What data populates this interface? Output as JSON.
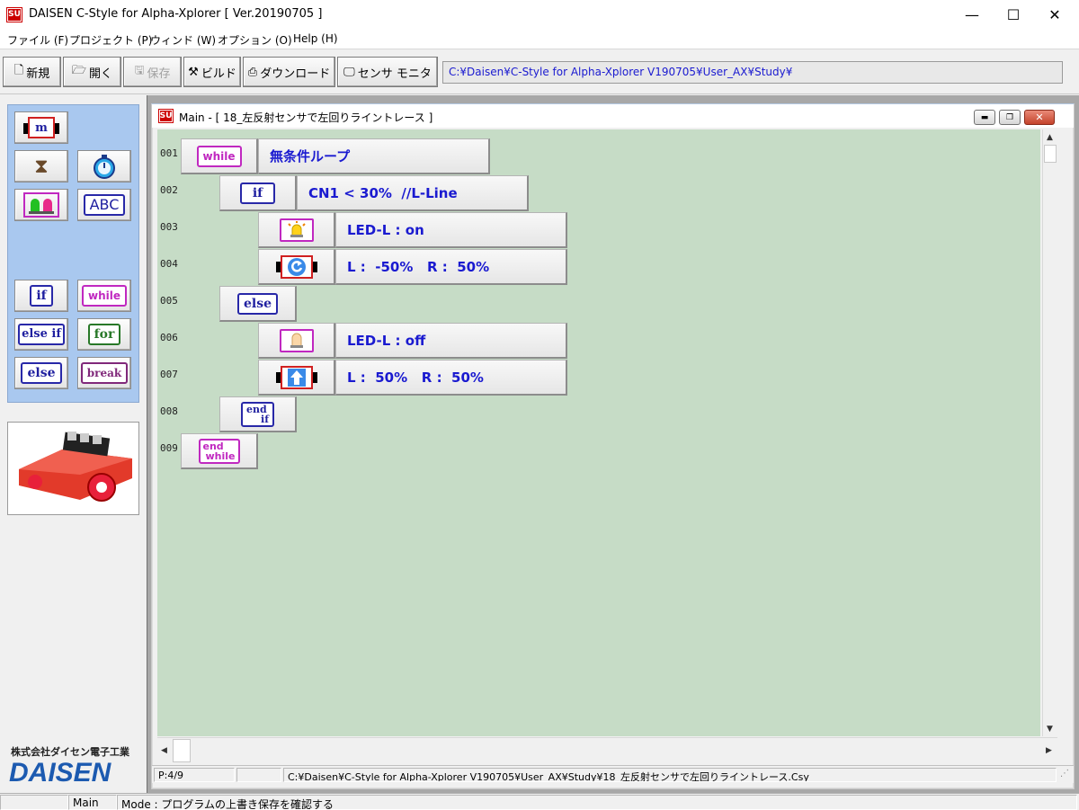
{
  "window": {
    "icon_text": "SU",
    "title": "DAISEN C-Style for Alpha-Xplorer  [ Ver.20190705 ]",
    "minimize_glyph": "—",
    "maximize_glyph": "☐",
    "close_glyph": "✕"
  },
  "menu": [
    "ファイル (F)",
    "プロジェクト (P)",
    "ウィンド (W)",
    "オプション (O)",
    "Help (H)"
  ],
  "toolbar": {
    "buttons": [
      {
        "label": "新規",
        "icon": "new-file-icon"
      },
      {
        "label": "開く",
        "icon": "open-folder-icon"
      },
      {
        "label": "保存",
        "icon": "save-disk-icon",
        "disabled": true
      },
      {
        "label": "ビルド",
        "icon": "build-icon"
      },
      {
        "label": "ダウンロード",
        "icon": "download-icon"
      },
      {
        "label": "センサ モニタ",
        "icon": "monitor-icon"
      }
    ],
    "path": "C:¥Daisen¥C-Style for Alpha-Xplorer V190705¥User_AX¥Study¥"
  },
  "palette": {
    "motor_label": "m",
    "keywords": [
      "if",
      "while",
      "else if",
      "for",
      "else",
      "break"
    ]
  },
  "palette_abc": "ABC",
  "brand": {
    "jp": "株式会社ダイセン電子工業",
    "en": "DAISEN"
  },
  "child": {
    "title": "Main - [ 18_左反射センサで左回りライントレース ]",
    "icon_text": "SU",
    "lines": [
      {
        "no": "001",
        "kw": "while",
        "text": "無条件ループ"
      },
      {
        "no": "002",
        "kw": "if",
        "text": "CN1 < 30%  //L-Line"
      },
      {
        "no": "003",
        "text": "LED-L : on"
      },
      {
        "no": "004",
        "text": "L :  -50%   R :  50%"
      },
      {
        "no": "005",
        "kw": "else"
      },
      {
        "no": "006",
        "text": "LED-L : off"
      },
      {
        "no": "007",
        "text": "L :  50%   R :  50%"
      },
      {
        "no": "008",
        "kw_top": "end",
        "kw_bottom": "if"
      },
      {
        "no": "009",
        "kw_top": "end",
        "kw_bottom": "while"
      }
    ],
    "status": {
      "position": "P:4/9",
      "file": "C:¥Daisen¥C-Style for Alpha-Xplorer V190705¥User_AX¥Study¥18_左反射センサで左回りライントレース.Csy"
    }
  },
  "statusbar": {
    "window": "Main",
    "mode": "Mode : プログラムの上書き保存を確認する"
  },
  "colors": {
    "canvas": "#c6dcc6",
    "palette": "#a9c8ef",
    "code_text": "#1a1ad0",
    "while_kw": "#c028c0",
    "if_kw": "#2020a0"
  }
}
